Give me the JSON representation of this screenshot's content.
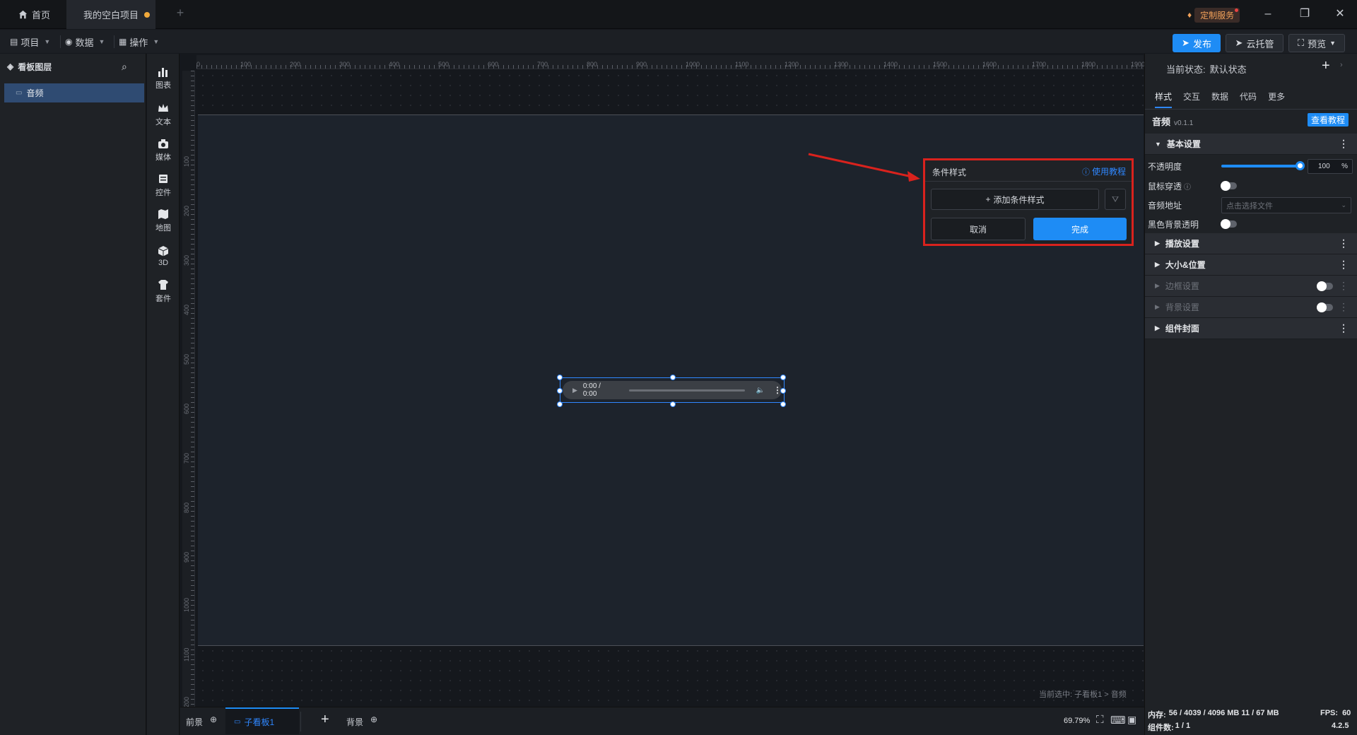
{
  "titlebar": {
    "home_tab": "首页",
    "project_tab": "我的空白项目",
    "custom_service": "定制服务"
  },
  "menubar": {
    "menus": [
      "项目",
      "数据",
      "操作"
    ],
    "publish": "发布",
    "cloud_host": "云托管",
    "preview": "预览"
  },
  "layers": {
    "title": "看板图层",
    "items": [
      "音频"
    ]
  },
  "tools": [
    "图表",
    "文本",
    "媒体",
    "控件",
    "地图",
    "3D",
    "套件"
  ],
  "ruler": {
    "top": [
      "0",
      "100",
      "200",
      "300",
      "400",
      "500",
      "600",
      "700",
      "800",
      "900",
      "1000",
      "1100",
      "1200",
      "1300",
      "1400",
      "1500",
      "1600",
      "1700",
      "1800",
      "1900"
    ],
    "left": [
      "100",
      "200",
      "300",
      "400",
      "500",
      "600",
      "700",
      "800",
      "900",
      "1000",
      "1100",
      "1200"
    ]
  },
  "audio_widget": {
    "time": "0:00 / 0:00"
  },
  "popup": {
    "title": "条件样式",
    "tutorial_link": "使用教程",
    "add_button": "添加条件样式",
    "cancel": "取消",
    "done": "完成"
  },
  "rightpanel": {
    "state_label": "当前状态:",
    "state_value": "默认状态",
    "tabs": [
      "样式",
      "交互",
      "数据",
      "代码",
      "更多"
    ],
    "component_name": "音频",
    "version": "v0.1.1",
    "tutorial_button": "查看教程",
    "sections": {
      "basic": "基本设置",
      "playback": "播放设置",
      "size_position": "大小&位置",
      "border": "边框设置",
      "background": "背景设置",
      "cover": "组件封面"
    },
    "opacity_label": "不透明度",
    "opacity_value": "100",
    "opacity_unit": "%",
    "opacity_level": 1.0,
    "mouse_through_label": "鼠标穿透",
    "audio_url_label": "音频地址",
    "audio_url_placeholder": "点击选择文件",
    "black_bg_label": "黑色背景透明"
  },
  "bottombar": {
    "foreground": "前景",
    "subboard": "子看板1",
    "background": "背景",
    "zoom": "69.79%",
    "selection": "当前选中: 子看板1 > 音频"
  },
  "statusbar": {
    "memory_label": "内存:",
    "memory_value": "56 / 4039 / 4096 MB  11 / 67 MB",
    "fps_label": "FPS:",
    "fps_value": "60",
    "components_label": "组件数:",
    "components_value": "1 / 1",
    "version": "4.2.5"
  },
  "colors": {
    "accent": "#1e8cf5",
    "highlight_border": "#d9221d",
    "arrow": "#d9221d"
  }
}
